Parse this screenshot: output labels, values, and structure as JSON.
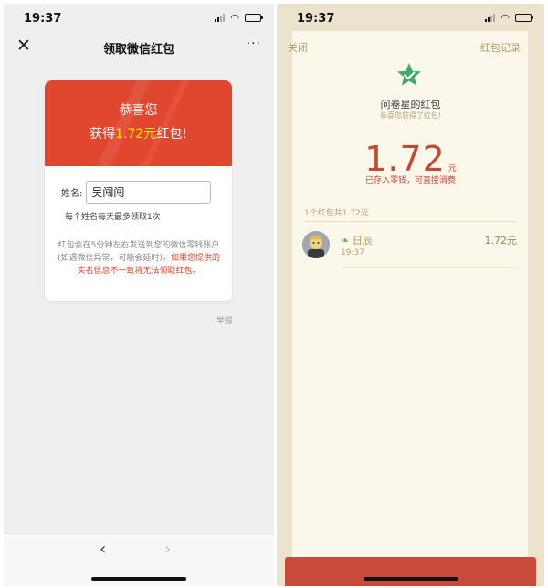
{
  "left": {
    "status": {
      "time": "19:37"
    },
    "nav": {
      "close_icon": "close-icon",
      "title": "领取微信红包",
      "more_label": "···"
    },
    "card": {
      "line1": "恭喜您",
      "line2_prefix": "获得",
      "amount": "1.72元",
      "line2_suffix": "红包!",
      "name_label": "姓名:",
      "name_value": "吴闯闯",
      "limit_text": "每个姓名每天最多领取1次",
      "notice_gray": "红包会在5分钟左右发送到您的微信零钱账户(如遇微信异常，可能会延时)。",
      "notice_red": "如果您提供的实名信息不一致将无法领取红包。"
    },
    "report_label": "举报",
    "bottom": {
      "back_label": "‹",
      "forward_label": "›"
    },
    "colors": {
      "header_red": "#e1462f",
      "amount_yellow": "#ffe600",
      "warn_red": "#e0452e"
    }
  },
  "right": {
    "status": {
      "time": "19:37"
    },
    "close_label": "关闭",
    "record_label": "红包记录",
    "logo_icon": "green-star-icon",
    "sender_name": "问卷星的红包",
    "wish": "恭喜您获得了红包!",
    "amount": "1.72",
    "unit": "元",
    "stored_text": "已存入零钱，可直接消费",
    "summary": "1个红包共1.72元",
    "records": [
      {
        "name": "日辰",
        "time": "19:37",
        "amount": "1.72元"
      }
    ],
    "colors": {
      "gold": "#b59b63",
      "amount_red": "#c34a35",
      "bg": "#ece3cd",
      "bottom_red": "#c94a3a"
    }
  }
}
